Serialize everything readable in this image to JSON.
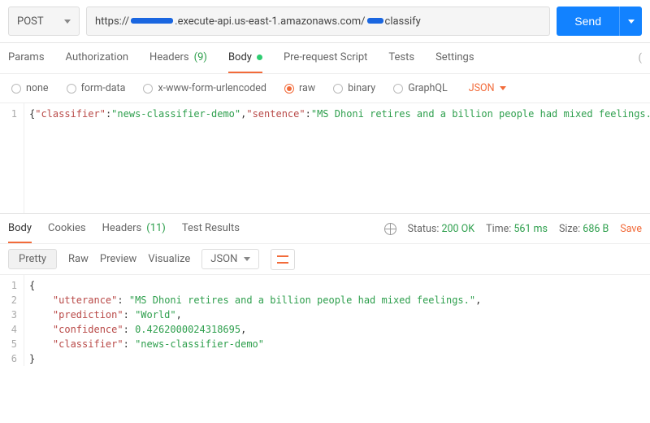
{
  "request": {
    "method": "POST",
    "url_prefix": "https://",
    "url_mid": ".execute-api.us-east-1.amazonaws.com/",
    "url_suffix": "classify",
    "send_label": "Send"
  },
  "tabs": {
    "params": "Params",
    "authorization": "Authorization",
    "headers": "Headers",
    "headers_count": "(9)",
    "body": "Body",
    "prerequest": "Pre-request Script",
    "tests": "Tests",
    "settings": "Settings"
  },
  "body_types": {
    "none": "none",
    "formdata": "form-data",
    "xwww": "x-www-form-urlencoded",
    "raw": "raw",
    "binary": "binary",
    "graphql": "GraphQL",
    "json_label": "JSON"
  },
  "request_body": {
    "line_nums": [
      "1"
    ],
    "json": {
      "classifier": "news-classifier-demo",
      "sentence": "MS Dhoni retires and a billion people had mixed feelings."
    }
  },
  "response_tabs": {
    "body": "Body",
    "cookies": "Cookies",
    "headers": "Headers",
    "headers_count": "(11)",
    "test_results": "Test Results"
  },
  "response_meta": {
    "status_label": "Status:",
    "status_value": "200 OK",
    "time_label": "Time:",
    "time_value": "561 ms",
    "size_label": "Size:",
    "size_value": "686 B",
    "save": "Save"
  },
  "pretty_row": {
    "pretty": "Pretty",
    "raw": "Raw",
    "preview": "Preview",
    "visualize": "Visualize",
    "json": "JSON"
  },
  "response_body": {
    "line_nums": [
      "1",
      "2",
      "3",
      "4",
      "5",
      "6"
    ],
    "json": {
      "utterance": "MS Dhoni retires and a billion people had mixed feelings.",
      "prediction": "World",
      "confidence": 0.4262000024318695,
      "classifier": "news-classifier-demo"
    }
  }
}
